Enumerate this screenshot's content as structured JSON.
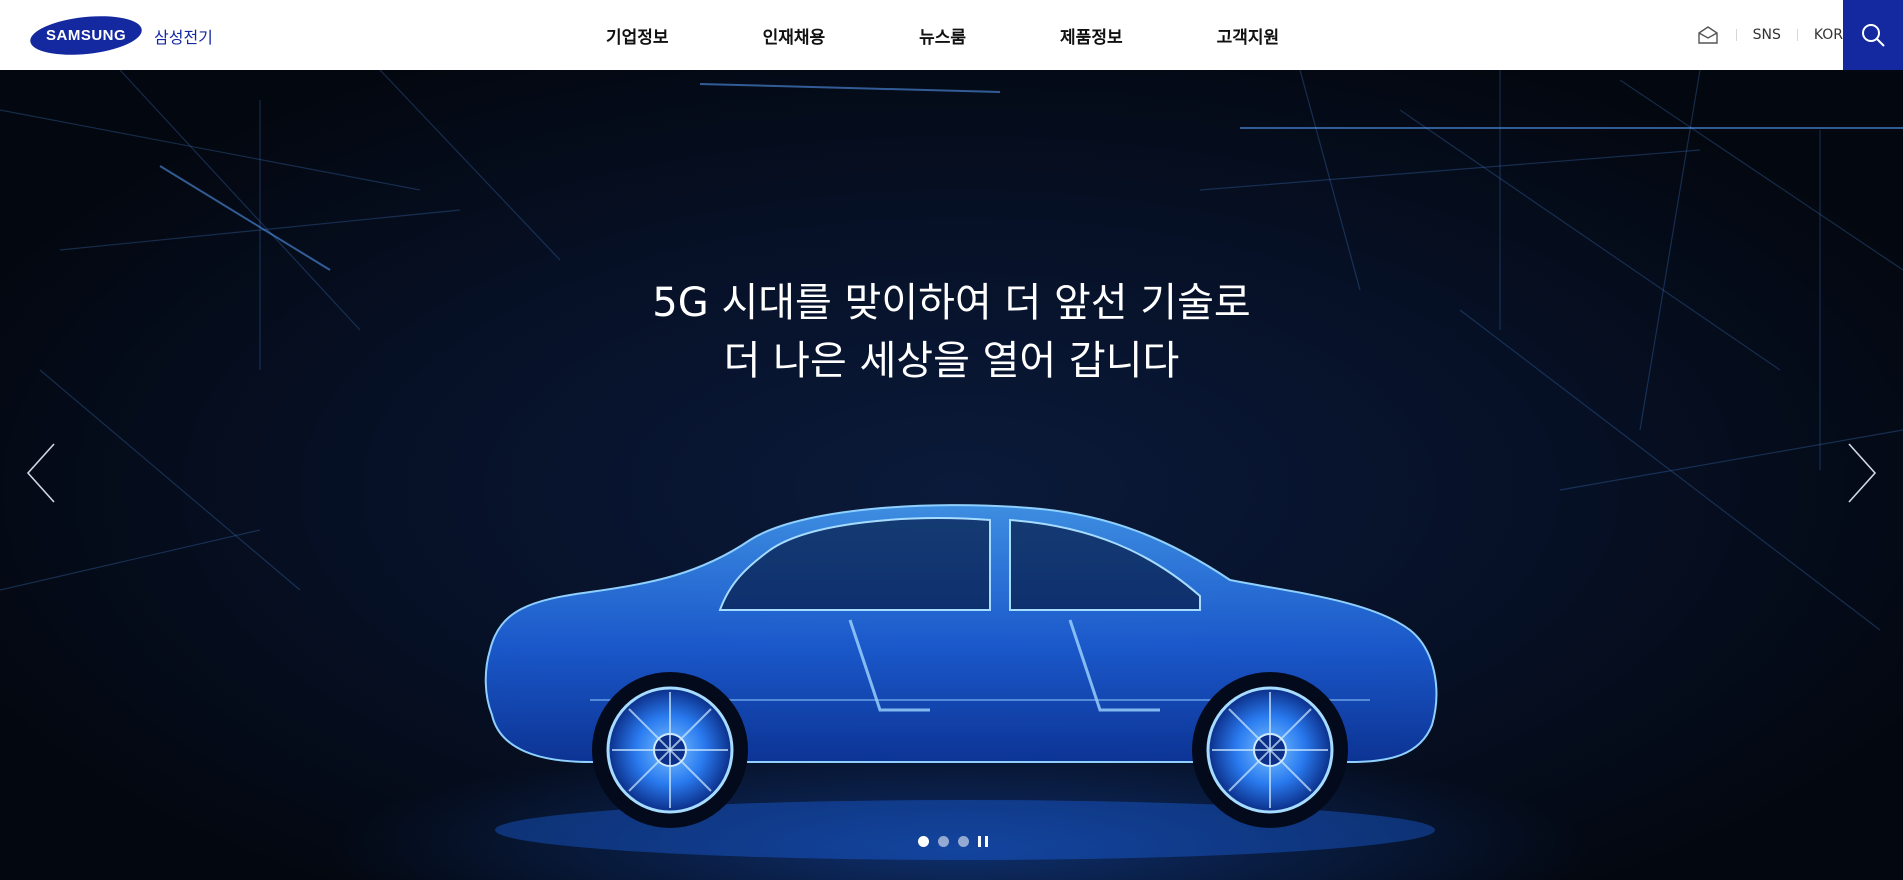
{
  "brand": {
    "logo_text": "SAMSUNG",
    "sub_label": "삼성전기",
    "color": "#1428a0"
  },
  "nav": {
    "items": [
      "기업정보",
      "인재채용",
      "뉴스룸",
      "제품정보",
      "고객지원"
    ]
  },
  "utility": {
    "mail_icon": "mail-icon",
    "sns_label": "SNS",
    "lang_label": "KOR",
    "search_icon": "search-icon"
  },
  "hero": {
    "title_line1": "5G 시대를 맞이하여 더 앞선 기술로",
    "title_line2": "더 나은 세상을 열어 갑니다",
    "prev_icon": "chevron-left-icon",
    "next_icon": "chevron-right-icon",
    "slides_total": 3,
    "active_slide": 1,
    "pause_icon": "pause-icon"
  }
}
